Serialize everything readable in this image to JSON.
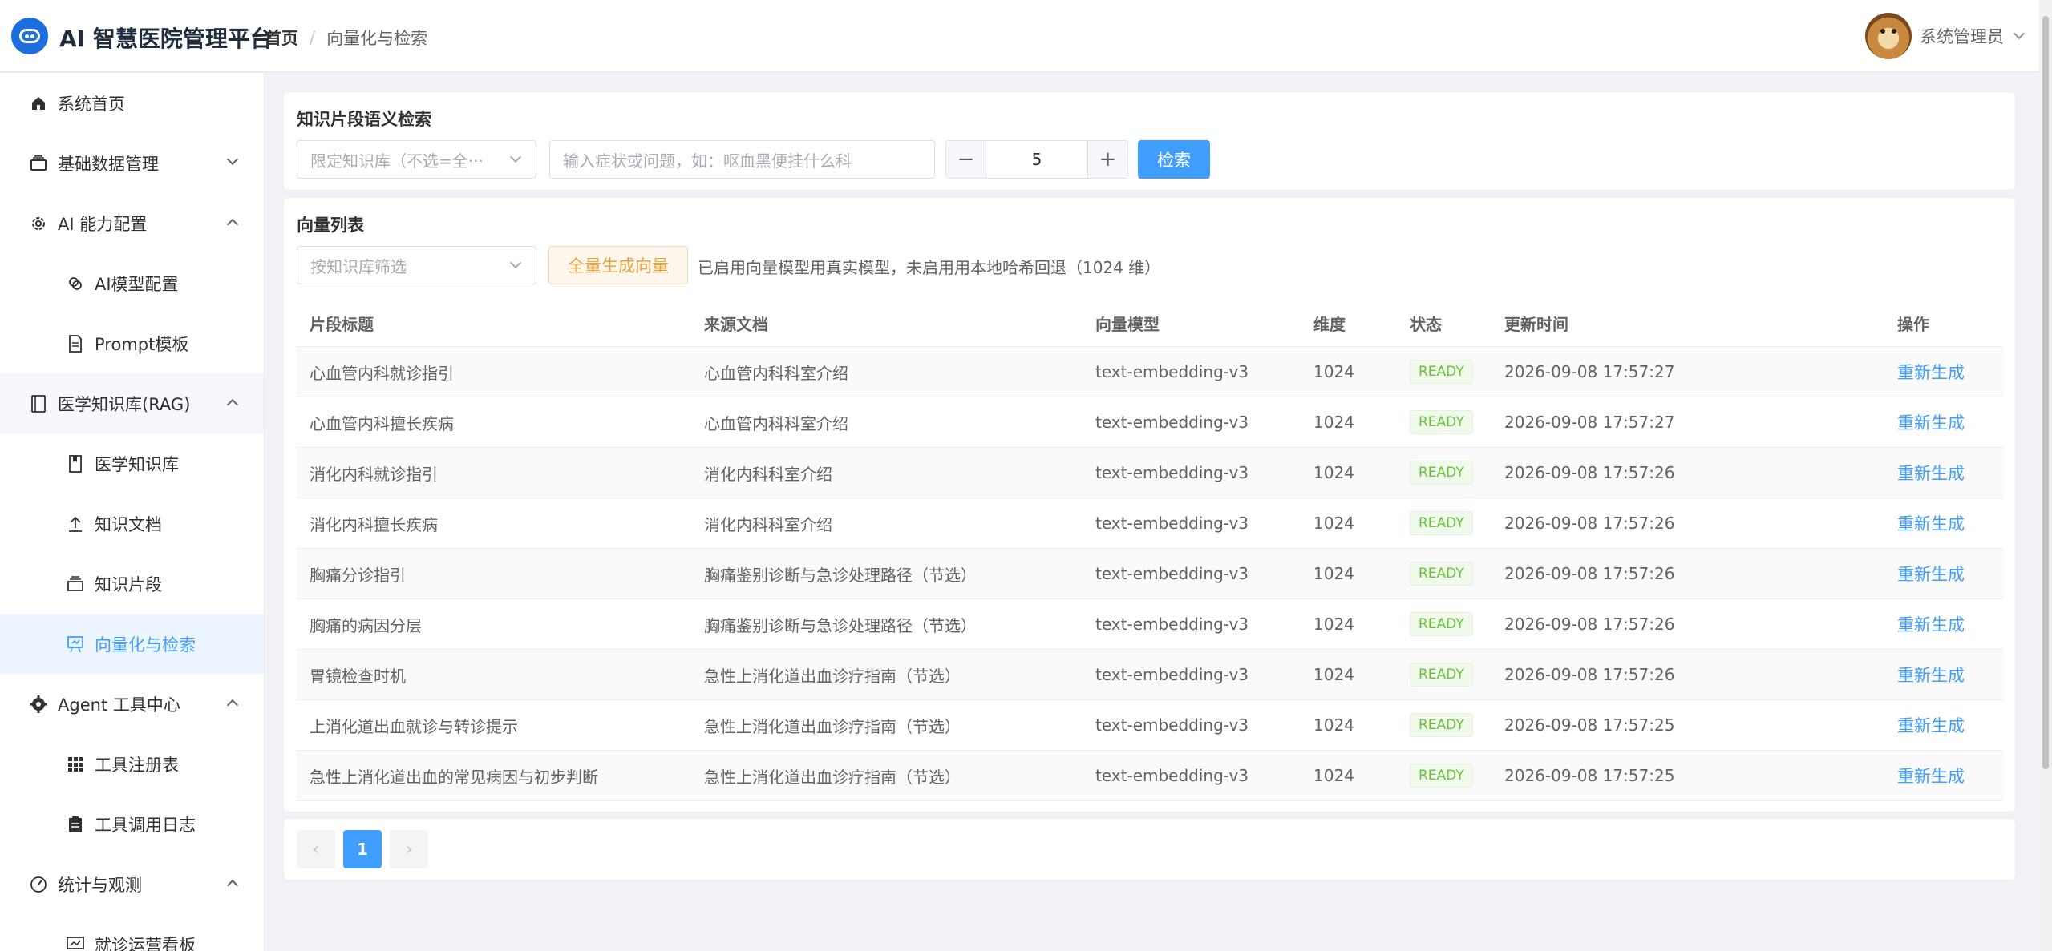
{
  "app": {
    "title": "AI 智慧医院管理平台"
  },
  "breadcrumb": {
    "home": "首页",
    "separator": "/",
    "current": "向量化与检索"
  },
  "user": {
    "name": "系统管理员"
  },
  "sidebar": {
    "items": [
      {
        "label": "系统首页",
        "icon": "home-icon"
      },
      {
        "label": "基础数据管理",
        "icon": "database-icon"
      },
      {
        "label": "AI 能力配置",
        "icon": "gear-icon"
      },
      {
        "label": "AI模型配置",
        "icon": "model-icon"
      },
      {
        "label": "Prompt模板",
        "icon": "document-icon"
      },
      {
        "label": "医学知识库(RAG)",
        "icon": "book-icon"
      },
      {
        "label": "医学知识库",
        "icon": "bookmark-icon"
      },
      {
        "label": "知识文档",
        "icon": "upload-icon"
      },
      {
        "label": "知识片段",
        "icon": "layers-icon"
      },
      {
        "label": "向量化与检索",
        "icon": "vector-icon"
      },
      {
        "label": "Agent 工具中心",
        "icon": "cog-icon"
      },
      {
        "label": "工具注册表",
        "icon": "grid-icon"
      },
      {
        "label": "工具调用日志",
        "icon": "clipboard-icon"
      },
      {
        "label": "统计与观测",
        "icon": "gauge-icon"
      },
      {
        "label": "就诊运营看板",
        "icon": "chart-icon"
      }
    ]
  },
  "search": {
    "title": "知识片段语义检索",
    "kb_placeholder": "限定知识库（不选=全部）",
    "kb_display": "限定知识库（不选=全···",
    "query_placeholder": "输入症状或问题，如：呕血黑便挂什么科",
    "topk": "5",
    "minus": "−",
    "plus": "+",
    "button": "检索"
  },
  "vectors": {
    "title": "向量列表",
    "filter_placeholder": "按知识库筛选",
    "generate_all": "全量生成向量",
    "hint": "已启用向量模型用真实模型，未启用用本地哈希回退（1024 维）",
    "columns": [
      "片段标题",
      "来源文档",
      "向量模型",
      "维度",
      "状态",
      "更新时间",
      "操作"
    ],
    "rows": [
      {
        "title": "心血管内科就诊指引",
        "doc": "心血管内科科室介绍",
        "model": "text-embedding-v3",
        "dim": "1024",
        "status": "READY",
        "time": "2026-09-08 17:57:27",
        "action": "重新生成"
      },
      {
        "title": "心血管内科擅长疾病",
        "doc": "心血管内科科室介绍",
        "model": "text-embedding-v3",
        "dim": "1024",
        "status": "READY",
        "time": "2026-09-08 17:57:27",
        "action": "重新生成"
      },
      {
        "title": "消化内科就诊指引",
        "doc": "消化内科科室介绍",
        "model": "text-embedding-v3",
        "dim": "1024",
        "status": "READY",
        "time": "2026-09-08 17:57:26",
        "action": "重新生成"
      },
      {
        "title": "消化内科擅长疾病",
        "doc": "消化内科科室介绍",
        "model": "text-embedding-v3",
        "dim": "1024",
        "status": "READY",
        "time": "2026-09-08 17:57:26",
        "action": "重新生成"
      },
      {
        "title": "胸痛分诊指引",
        "doc": "胸痛鉴别诊断与急诊处理路径（节选）",
        "model": "text-embedding-v3",
        "dim": "1024",
        "status": "READY",
        "time": "2026-09-08 17:57:26",
        "action": "重新生成"
      },
      {
        "title": "胸痛的病因分层",
        "doc": "胸痛鉴别诊断与急诊处理路径（节选）",
        "model": "text-embedding-v3",
        "dim": "1024",
        "status": "READY",
        "time": "2026-09-08 17:57:26",
        "action": "重新生成"
      },
      {
        "title": "胃镜检查时机",
        "doc": "急性上消化道出血诊疗指南（节选）",
        "model": "text-embedding-v3",
        "dim": "1024",
        "status": "READY",
        "time": "2026-09-08 17:57:26",
        "action": "重新生成"
      },
      {
        "title": "上消化道出血就诊与转诊提示",
        "doc": "急性上消化道出血诊疗指南（节选）",
        "model": "text-embedding-v3",
        "dim": "1024",
        "status": "READY",
        "time": "2026-09-08 17:57:25",
        "action": "重新生成"
      },
      {
        "title": "急性上消化道出血的常见病因与初步判断",
        "doc": "急性上消化道出血诊疗指南（节选）",
        "model": "text-embedding-v3",
        "dim": "1024",
        "status": "READY",
        "time": "2026-09-08 17:57:25",
        "action": "重新生成"
      }
    ]
  },
  "pagination": {
    "prev": "‹",
    "current": "1",
    "next": "›"
  },
  "colors": {
    "primary": "#409eff",
    "success": "#67c23a",
    "warning": "#e6a23c",
    "brand": "#1d6fe0"
  }
}
